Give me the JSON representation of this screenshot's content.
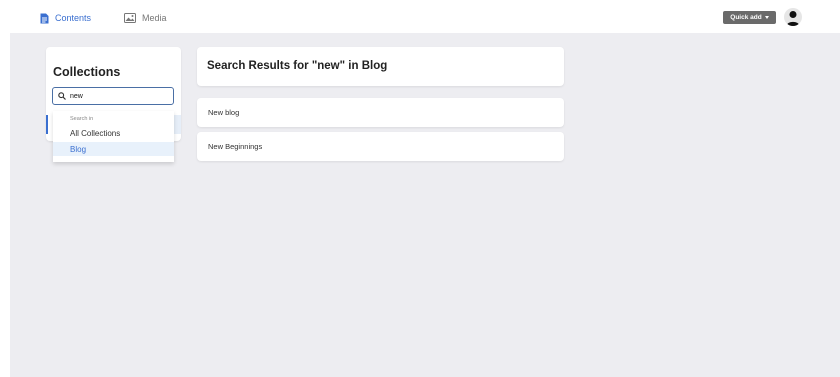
{
  "nav": {
    "contents_label": "Contents",
    "media_label": "Media"
  },
  "header": {
    "quick_add_label": "Quick add"
  },
  "collections": {
    "title": "Collections",
    "search_value": "new"
  },
  "search_dropdown": {
    "header": "Search in",
    "options": [
      "All Collections",
      "Blog"
    ],
    "selected": "Blog"
  },
  "results": {
    "title": "Search Results for \"new\" in Blog",
    "items": [
      {
        "label": "New blog"
      },
      {
        "label": "New Beginnings"
      }
    ]
  },
  "colors": {
    "accent": "#3a6fd0",
    "background": "#ededf1",
    "quick_add_bg": "#6a6a6a"
  }
}
